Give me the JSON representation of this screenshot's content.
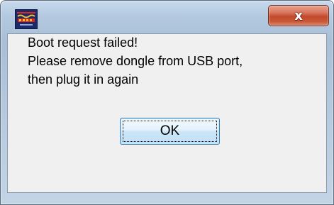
{
  "window": {
    "title": "",
    "icon": "app-logo-icon",
    "close_label": "x",
    "colors": {
      "frame": "#b3c9e0",
      "client": "#f0f0f0",
      "close_button": "#c14a2c",
      "ok_button": "#cde6f8"
    }
  },
  "dialog": {
    "message_lines": [
      "Boot request failed!",
      "Please remove dongle from USB port,",
      "then plug it in again"
    ],
    "ok_label": "OK"
  }
}
